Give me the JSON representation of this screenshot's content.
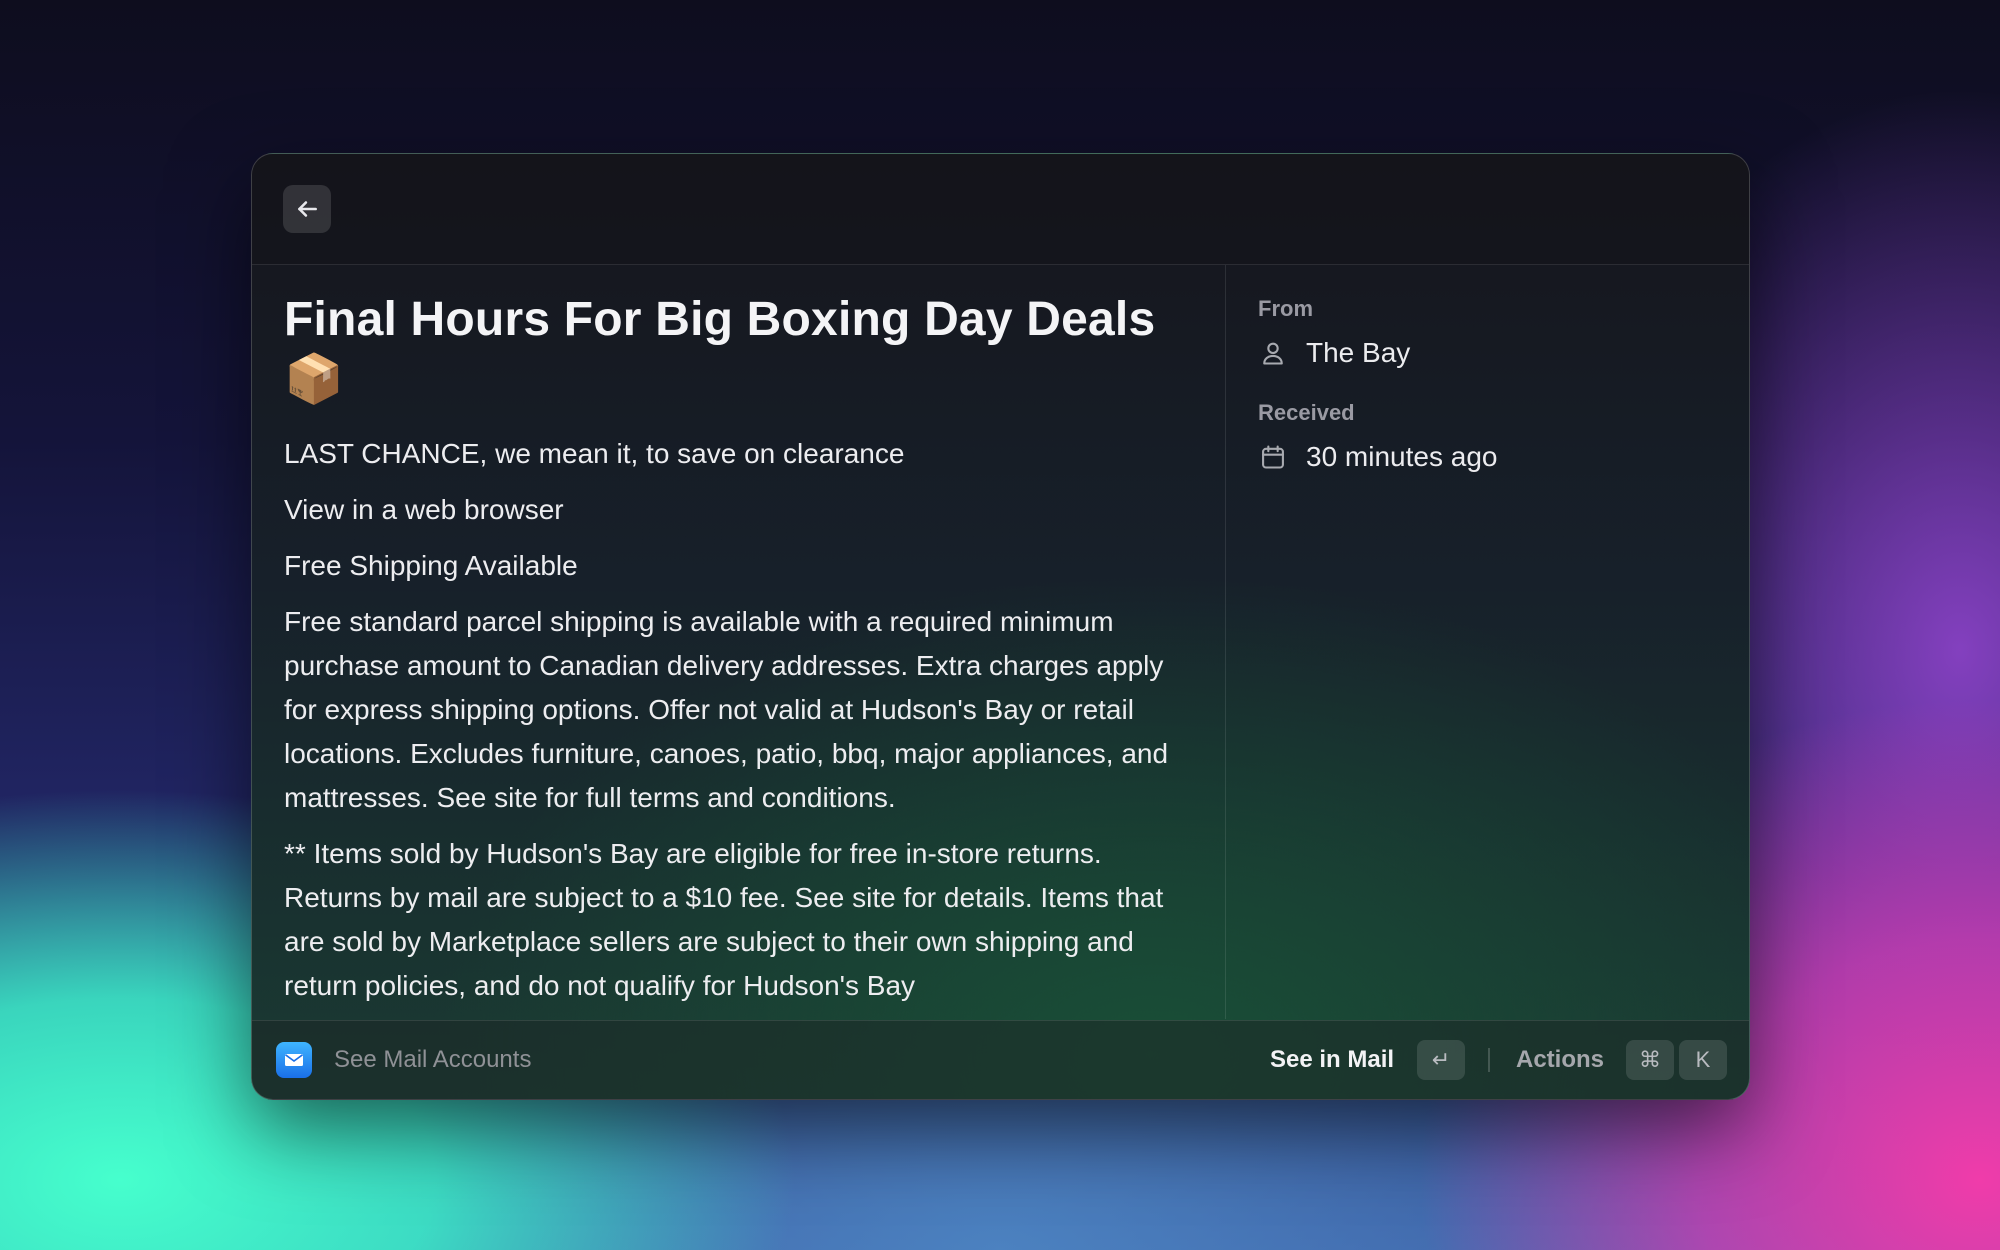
{
  "header": {
    "back_icon": "arrow-left-icon"
  },
  "email": {
    "subject": "Final Hours For Big Boxing Day Deals",
    "subject_emoji": "📦",
    "body": [
      "LAST CHANCE, we mean it, to save on clearance",
      "View in a web browser",
      "Free Shipping Available",
      "Free standard parcel shipping is available with a required minimum purchase amount to Canadian delivery addresses. Extra charges apply for express shipping options. Offer not valid at Hudson's Bay or retail locations. Excludes furniture, canoes, patio, bbq, major appliances, and mattresses. See site for full terms and conditions.",
      "** Items sold by Hudson's Bay are eligible for free in-store returns. Returns by mail are subject to a $10 fee. See site for details. Items that are sold by Marketplace sellers are subject to their own shipping and return policies, and do not qualify for Hudson's Bay"
    ]
  },
  "meta": {
    "from_label": "From",
    "from_value": "The Bay",
    "from_icon": "person-icon",
    "received_label": "Received",
    "received_value": "30 minutes ago",
    "received_icon": "calendar-icon"
  },
  "footer": {
    "app_icon": "mail-app-icon",
    "see_accounts": "See Mail Accounts",
    "primary_action": "See in Mail",
    "primary_key": "↵",
    "actions_label": "Actions",
    "actions_key_1": "⌘",
    "actions_key_2": "K"
  }
}
